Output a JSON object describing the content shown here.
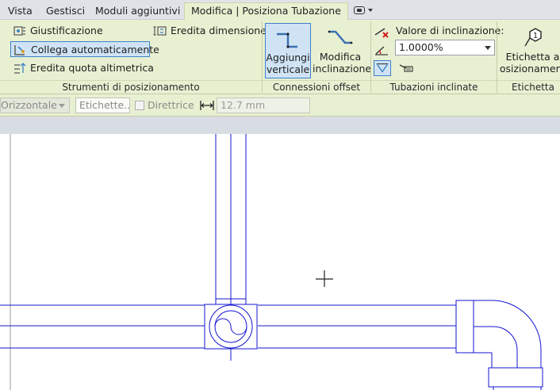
{
  "tabs": [
    {
      "label": "Vista"
    },
    {
      "label": "Gestisci"
    },
    {
      "label": "Moduli aggiuntivi"
    },
    {
      "label": "Modifica | Posiziona Tubazione"
    }
  ],
  "ribbon": {
    "positioning_tools": {
      "title": "Strumenti di posizionamento",
      "justification": "Giustificazione",
      "auto_connect": "Collega automaticamente",
      "inherit_elevation": "Eredita quota altimetrica",
      "inherit_size": "Eredita dimensione"
    },
    "offset_connections": {
      "title": "Connessioni offset",
      "add_vertical": "Aggiungi verticale",
      "change_slope": "Modifica inclinazione"
    },
    "sloped_piping": {
      "title": "Tubazioni inclinate",
      "slope_value_label": "Valore di inclinazione:",
      "slope_value": "1.0000%"
    },
    "tag": {
      "title": "Etichetta",
      "tag_on_placement": "Etichetta a posizionamento",
      "tag_number": "1"
    }
  },
  "options_bar": {
    "orientation": "Orizzontale",
    "tags_placeholder": "Etichette...",
    "leader_label": "Direttrice",
    "length_value": "12.7 mm"
  },
  "colors": {
    "ribbon_bg": "#e8f0d2",
    "selected_bg": "#cfe3f5",
    "selected_border": "#3d82c8",
    "pipe_line": "#1414d2"
  }
}
